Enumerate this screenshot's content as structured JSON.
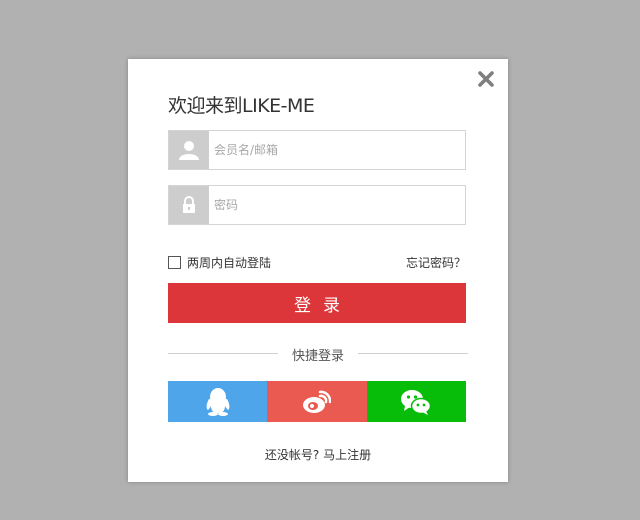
{
  "login": {
    "title": "欢迎来到LIKE-ME",
    "username_placeholder": "会员名/邮箱",
    "password_placeholder": "密码",
    "remember_label": "两周内自动登陆",
    "forgot_label": "忘记密码？",
    "login_button": "登录",
    "quick_login": "快捷登录",
    "register_prompt": "还没帐号? ",
    "register_link": "马上注册"
  },
  "colors": {
    "overlay": "#b1b1b1",
    "login_button": "#dc363b",
    "qq": "#4ea5e9",
    "weibo": "#ea5a51",
    "wechat": "#07bd0a"
  },
  "social": [
    {
      "icon": "qq-icon",
      "color": "#4ea5e9"
    },
    {
      "icon": "weibo-icon",
      "color": "#ea5a51"
    },
    {
      "icon": "wechat-icon",
      "color": "#07bd0a"
    }
  ]
}
